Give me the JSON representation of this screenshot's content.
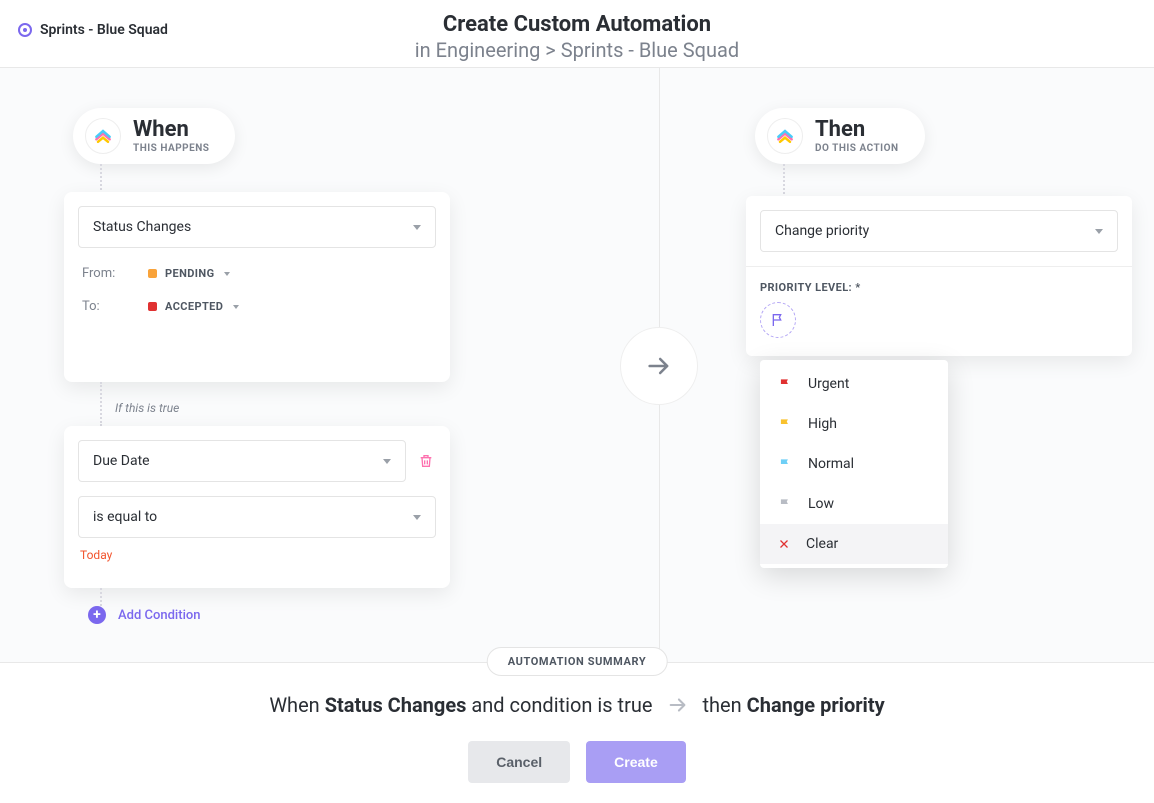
{
  "header": {
    "location": "Sprints - Blue Squad",
    "title": "Create Custom Automation",
    "subtitle_prefix": "in ",
    "subtitle_path": "Engineering > Sprints - Blue Squad"
  },
  "when": {
    "title": "When",
    "subtitle": "THIS HAPPENS",
    "trigger_select": "Status Changes",
    "from_label": "From:",
    "from_status": "PENDING",
    "from_color": "#f9a33a",
    "to_label": "To:",
    "to_status": "ACCEPTED",
    "to_color": "#e03131",
    "condition_intro": "If this is true",
    "cond_field_select": "Due Date",
    "cond_op_select": "is equal to",
    "cond_value_text": "Today",
    "add_condition_label": "Add Condition"
  },
  "then": {
    "title": "Then",
    "subtitle": "DO THIS ACTION",
    "action_select": "Change priority",
    "priority_label": "PRIORITY LEVEL: *",
    "priority_options": [
      {
        "label": "Urgent",
        "color": "#e03131"
      },
      {
        "label": "High",
        "color": "#f9c22e"
      },
      {
        "label": "Normal",
        "color": "#6ecff6"
      },
      {
        "label": "Low",
        "color": "#b8bcc4"
      }
    ],
    "clear_label": "Clear"
  },
  "summary": {
    "badge": "AUTOMATION SUMMARY",
    "pre_when": "When ",
    "trigger": "Status Changes",
    "and_cond": " and condition is true",
    "pre_then": "then ",
    "action": "Change priority"
  },
  "buttons": {
    "cancel": "Cancel",
    "create": "Create"
  }
}
